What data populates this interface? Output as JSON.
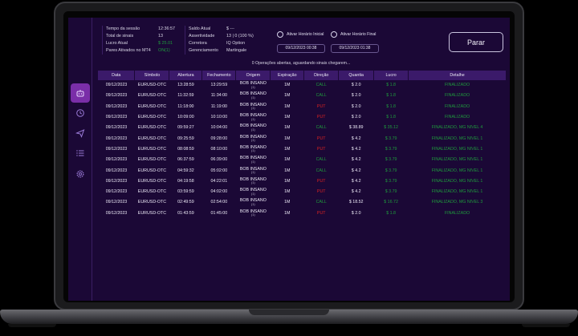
{
  "session": {
    "labels": [
      "Tempo da sessão",
      "Total de sinais",
      "Lucro Atual",
      "Pares Ativados no MT4"
    ],
    "values": [
      "12:36:57",
      "13",
      "$ 25.01",
      "ON(1)"
    ]
  },
  "account": {
    "labels": [
      "Saldo Atual",
      "Assertividade",
      "Corretora",
      "Gerenciamento"
    ],
    "values": [
      "$ ---",
      "13 | 0 (100 %)",
      "IQ Option",
      "Martingale"
    ]
  },
  "schedule": {
    "start_label": "Ativar Horário Inicial",
    "end_label": "Ativar Horário Final",
    "start_value": "09/12/2023 00:38",
    "end_value": "09/12/2023 01:38"
  },
  "stop_button": "Parar",
  "status_text": "0 Operações abertas, aguardando sinais chegarem...",
  "table": {
    "headers": [
      "Data",
      "Símbolo",
      "Abertura",
      "Fechamento",
      "Origem",
      "Expiração",
      "Direção",
      "Quantia",
      "Lucro",
      "Detalhe"
    ],
    "rows": [
      [
        "09/12/2023",
        "EURUSD-OTC",
        "13:28:59",
        "13:29:59",
        "BOB INSANO",
        "1M",
        "CALL",
        "$ 2.0",
        "$ 1.8",
        "FINALIZADO"
      ],
      [
        "09/12/2023",
        "EURUSD-OTC",
        "11:32:59",
        "11:34:00",
        "BOB INSANO",
        "1M",
        "CALL",
        "$ 2.0",
        "$ 1.8",
        "FINALIZADO"
      ],
      [
        "09/12/2023",
        "EURUSD-OTC",
        "11:18:00",
        "11:19:00",
        "BOB INSANO",
        "1M",
        "PUT",
        "$ 2.0",
        "$ 1.8",
        "FINALIZADO"
      ],
      [
        "09/12/2023",
        "EURUSD-OTC",
        "10:09:00",
        "10:10:00",
        "BOB INSANO",
        "1M",
        "PUT",
        "$ 2.0",
        "$ 1.8",
        "FINALIZADO"
      ],
      [
        "09/12/2023",
        "EURUSD-OTC",
        "09:59:27",
        "10:04:00",
        "BOB INSANO",
        "1M",
        "CALL",
        "$ 38.89",
        "$ 35.12",
        "FINALIZADO, MG NIVEL 4"
      ],
      [
        "09/12/2023",
        "EURUSD-OTC",
        "09:25:59",
        "09:28:00",
        "BOB INSANO",
        "1M",
        "PUT",
        "$ 4.2",
        "$ 3.79",
        "FINALIZADO, MG NIVEL 1"
      ],
      [
        "09/12/2023",
        "EURUSD-OTC",
        "08:08:59",
        "08:10:00",
        "BOB INSANO",
        "1M",
        "PUT",
        "$ 4.2",
        "$ 3.79",
        "FINALIZADO, MG NIVEL 1"
      ],
      [
        "09/12/2023",
        "EURUSD-OTC",
        "06:37:59",
        "06:39:00",
        "BOB INSANO",
        "1M",
        "CALL",
        "$ 4.2",
        "$ 3.79",
        "FINALIZADO, MG NIVEL 1"
      ],
      [
        "09/12/2023",
        "EURUSD-OTC",
        "04:59:32",
        "05:02:00",
        "BOB INSANO",
        "1M",
        "CALL",
        "$ 4.2",
        "$ 3.79",
        "FINALIZADO, MG NIVEL 1"
      ],
      [
        "09/12/2023",
        "EURUSD-OTC",
        "04:19:58",
        "04:22:01",
        "BOB INSANO",
        "1M",
        "PUT",
        "$ 4.2",
        "$ 3.79",
        "FINALIZADO, MG NIVEL 1"
      ],
      [
        "09/12/2023",
        "EURUSD-OTC",
        "03:59:59",
        "04:02:00",
        "BOB INSANO",
        "1M",
        "PUT",
        "$ 4.2",
        "$ 3.79",
        "FINALIZADO, MG NIVEL 1"
      ],
      [
        "09/12/2023",
        "EURUSD-OTC",
        "02:49:59",
        "02:54:00",
        "BOB INSANO",
        "1M",
        "CALL",
        "$ 18.52",
        "$ 16.72",
        "FINALIZADO, MG NIVEL 3"
      ],
      [
        "09/12/2023",
        "EURUSD-OTC",
        "01:43:59",
        "01:45:00",
        "BOB INSANO",
        "1M",
        "PUT",
        "$ 2.0",
        "$ 1.8",
        "FINALIZADO"
      ]
    ],
    "origin_sub": "(1)"
  },
  "colors": {
    "background": "#1b0836",
    "accent": "#7a2ea8",
    "call": "#1e9a3c",
    "put": "#d92121",
    "header": "#3b1a6a"
  },
  "sidebar_icons": [
    "robot-icon",
    "history-icon",
    "send-icon",
    "list-icon",
    "settings-icon"
  ]
}
